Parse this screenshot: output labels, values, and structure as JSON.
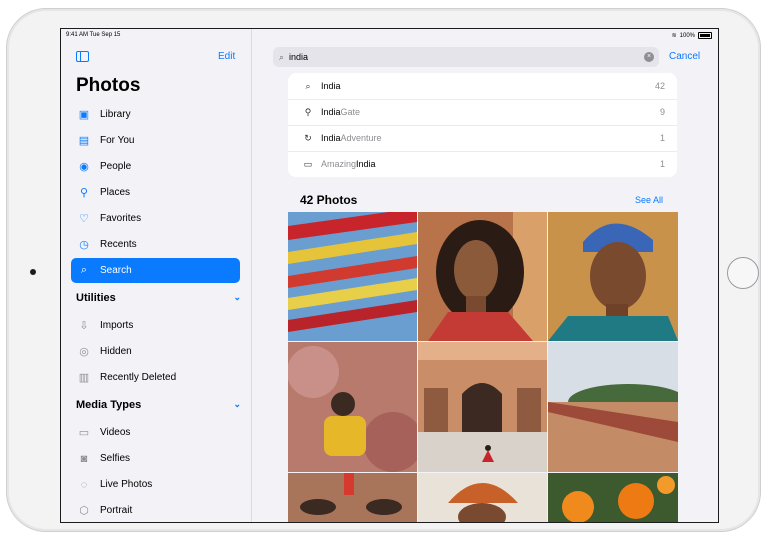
{
  "status_bar": {
    "time_date": "9:41 AM  Tue Sep 15",
    "battery": "100%"
  },
  "sidebar": {
    "edit_label": "Edit",
    "title": "Photos",
    "items": [
      {
        "label": "Library",
        "icon": "library-icon"
      },
      {
        "label": "For You",
        "icon": "for-you-icon"
      },
      {
        "label": "People",
        "icon": "people-icon"
      },
      {
        "label": "Places",
        "icon": "places-icon"
      },
      {
        "label": "Favorites",
        "icon": "heart-icon"
      },
      {
        "label": "Recents",
        "icon": "clock-icon"
      },
      {
        "label": "Search",
        "icon": "search-icon",
        "active": true
      }
    ],
    "utilities": {
      "title": "Utilities",
      "items": [
        {
          "label": "Imports",
          "icon": "imports-icon"
        },
        {
          "label": "Hidden",
          "icon": "hidden-icon"
        },
        {
          "label": "Recently Deleted",
          "icon": "trash-icon"
        }
      ]
    },
    "media_types": {
      "title": "Media Types",
      "items": [
        {
          "label": "Videos",
          "icon": "video-icon"
        },
        {
          "label": "Selfies",
          "icon": "selfie-icon"
        },
        {
          "label": "Live Photos",
          "icon": "live-photo-icon"
        },
        {
          "label": "Portrait",
          "icon": "portrait-icon"
        }
      ]
    }
  },
  "search": {
    "query": "india",
    "cancel_label": "Cancel",
    "suggestions": [
      {
        "bold": "India",
        "rest": "",
        "count": "42",
        "icon": "search-icon"
      },
      {
        "bold": "India",
        "rest": " Gate",
        "count": "9",
        "icon": "place-pin-icon"
      },
      {
        "bold": "India",
        "rest": " Adventure",
        "count": "1",
        "icon": "memory-icon"
      },
      {
        "bold": "India",
        "prefix": "Amazing ",
        "rest": "",
        "count": "1",
        "icon": "album-icon"
      }
    ]
  },
  "results": {
    "heading": "42 Photos",
    "see_all_label": "See All"
  },
  "colors": {
    "accent": "#0a7aff",
    "sidebar_bg": "#f2f2f7"
  }
}
